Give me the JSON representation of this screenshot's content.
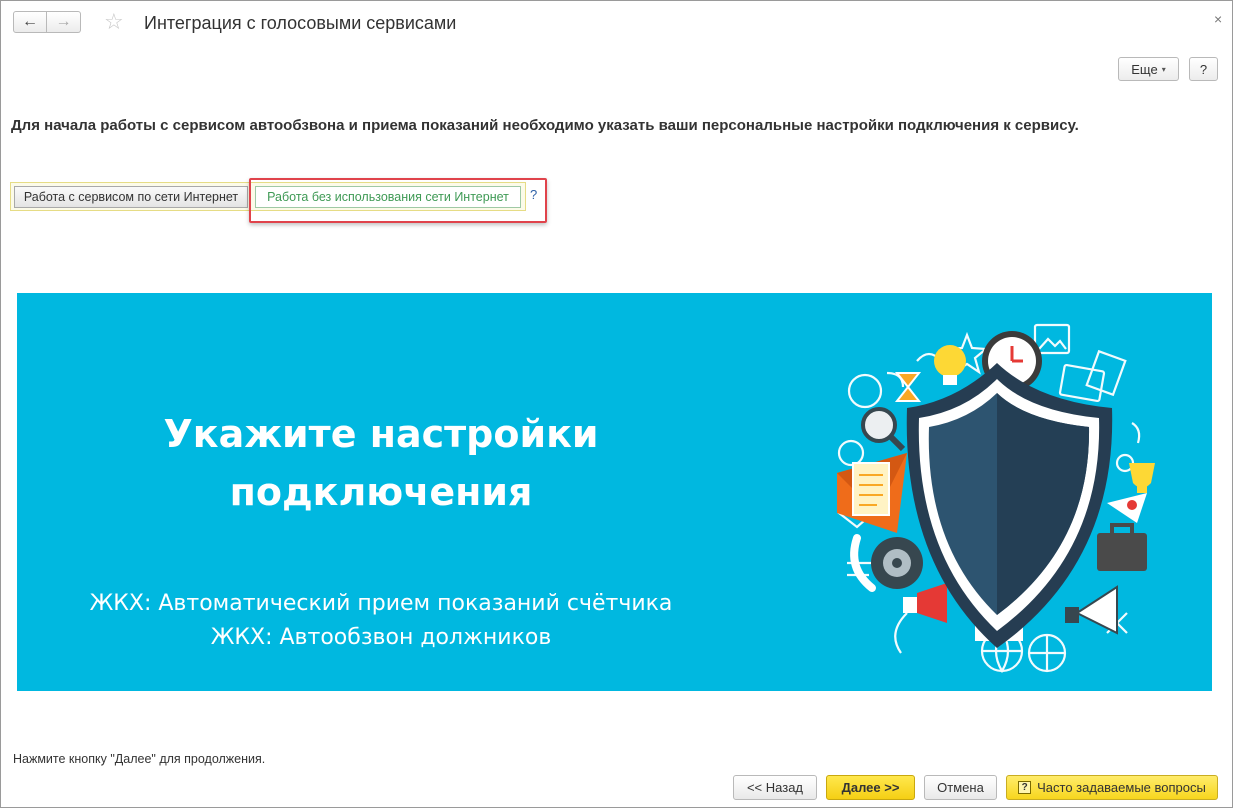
{
  "window": {
    "title": "Интеграция с голосовыми сервисами",
    "back_icon": "←",
    "forward_icon": "→",
    "star_icon": "☆",
    "close_icon": "×"
  },
  "toolbar": {
    "more_label": "Еще",
    "more_caret": "▾",
    "help_label": "?"
  },
  "intro_text": "Для начала работы с сервисом автообзвона и приема показаний необходимо указать ваши персональные настройки подключения к сервису.",
  "mode_switch": {
    "internet_label": "Работа с сервисом по сети Интернет",
    "offline_label": "Работа без использования сети Интернет",
    "help_label": "?",
    "selected": "offline"
  },
  "banner": {
    "heading_line1": "Укажите настройки",
    "heading_line2": "подключения",
    "sub_line1": "ЖКХ: Автоматический прием показаний счётчика",
    "sub_line2": "ЖКХ: Автообзвон должников",
    "background_color": "#00b8e0"
  },
  "footer": {
    "hint": "Нажмите кнопку \"Далее\" для продолжения.",
    "back_label": "<< Назад",
    "next_label": "Далее >>",
    "cancel_label": "Отмена",
    "faq_icon": "?",
    "faq_label": "Часто задаваемые вопросы"
  },
  "colors": {
    "accent_yellow": "#f7d61e",
    "highlight_red": "#e0434b",
    "offline_text": "#3f9a55"
  }
}
